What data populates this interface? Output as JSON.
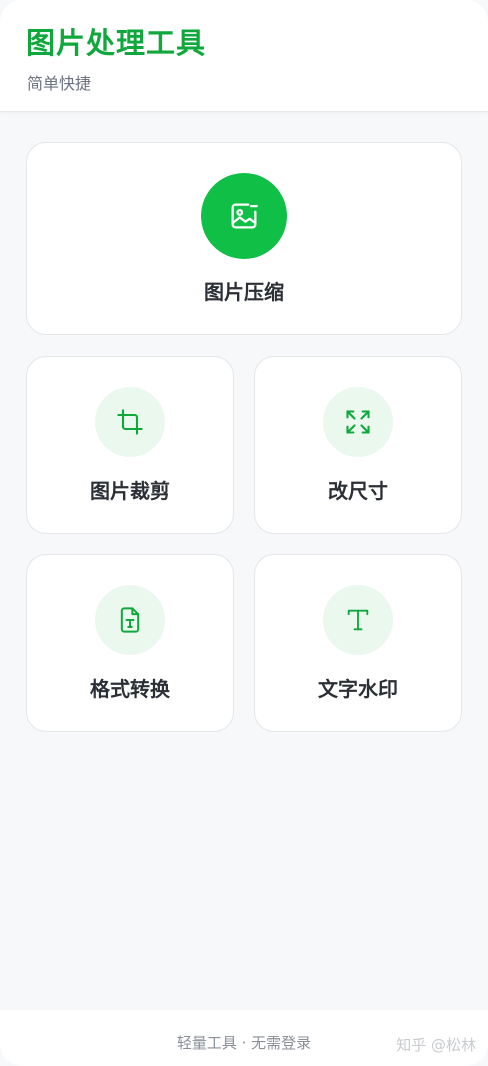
{
  "header": {
    "title": "图片处理工具",
    "subtitle": "简单快捷"
  },
  "tools": {
    "main": {
      "label": "图片压缩",
      "icon": "image-compress-icon"
    },
    "crop": {
      "label": "图片裁剪",
      "icon": "crop-icon"
    },
    "resize": {
      "label": "改尺寸",
      "icon": "resize-arrows-icon"
    },
    "format": {
      "label": "格式转换",
      "icon": "file-text-icon"
    },
    "watermark": {
      "label": "文字水印",
      "icon": "text-t-icon"
    }
  },
  "footer": {
    "text": "轻量工具 · 无需登录",
    "overlay": "知乎 @松林"
  },
  "colors": {
    "brand": "#10a83c",
    "accent": "#10c046",
    "icon_bg": "#eaf8ee"
  }
}
